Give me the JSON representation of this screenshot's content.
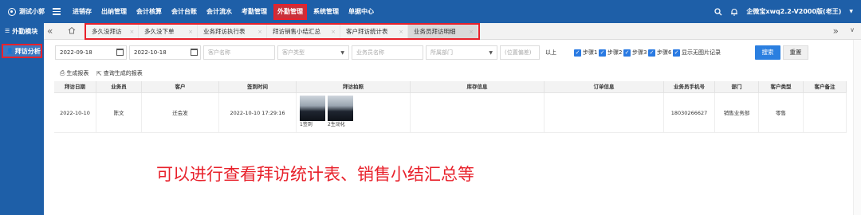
{
  "topbar": {
    "brand": "测试小郭",
    "menu": [
      "进销存",
      "出纳管理",
      "会计核算",
      "会计台账",
      "会计流水",
      "考勤管理",
      "外勤管理",
      "系统管理",
      "单据中心"
    ],
    "active_menu": "外勤管理",
    "user": "企微宝xwq2.2-V2000版(老王)",
    "icons": [
      "search-icon",
      "bell-icon",
      "chevron-down-icon"
    ]
  },
  "sidebar": {
    "header": "外勤模块",
    "item": "拜访分析"
  },
  "tabs": {
    "items": [
      "多久没拜访",
      "多久没下单",
      "业务拜访执行表",
      "拜访销售小结汇总",
      "客户拜访统计表",
      "业务员拜访明细"
    ],
    "active": "业务员拜访明细"
  },
  "filters": {
    "date_start": "2022-09-18",
    "date_end": "2022-10-18",
    "customer_name_ph": "客户名称",
    "customer_type_ph": "客户类型",
    "salesman_ph": "业务员名称",
    "dept_ph": "所属部门",
    "offset_ph": "(位置偏差)",
    "above": "以上",
    "steps": [
      "步骤1",
      "步骤2",
      "步骤3",
      "步骤6",
      "显示无图片记录"
    ],
    "search": "搜索",
    "reset": "重置"
  },
  "toolbar": {
    "generate": "生成报表",
    "query": "查询生成的报表"
  },
  "table": {
    "columns": [
      "拜访日期",
      "业务员",
      "客户",
      "签到时间",
      "拜访拍照",
      "库存信息",
      "订单信息",
      "业务员手机号",
      "部门",
      "客户类型",
      "客户备注"
    ],
    "rows": [
      {
        "date": "2022-10-10",
        "salesman": "陈文",
        "customer": "迁会发",
        "checkin": "2022-10-10 17:29:16",
        "photo_captions": [
          "1签到",
          "2生动化"
        ],
        "stock": "",
        "order": "",
        "phone": "18030266627",
        "dept": "销售业务部",
        "ctype": "零售",
        "note": ""
      }
    ]
  },
  "annotation": "可以进行查看拜访统计表、销售小结汇总等",
  "colors": {
    "brand_blue": "#1e5fa8",
    "highlight_red": "#e8212b",
    "button_blue": "#2b7fe0"
  }
}
